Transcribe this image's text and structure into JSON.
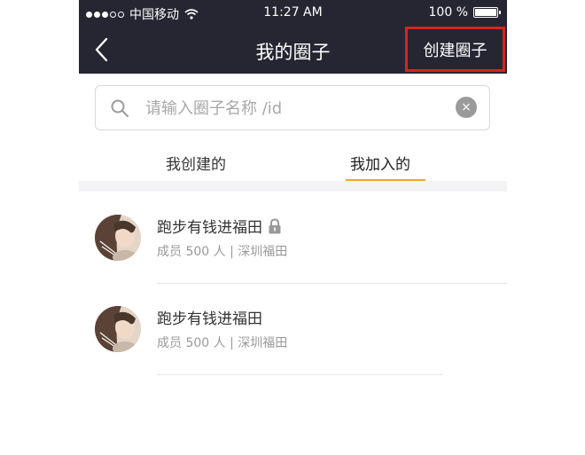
{
  "status_bar": {
    "carrier": "中国移动",
    "time": "11:27 AM",
    "battery": "100 %"
  },
  "navbar": {
    "back_icon": "chevron-left-icon",
    "title": "我的圈子",
    "create_label": "创建圈子"
  },
  "search": {
    "placeholder": "请输入圈子名称 /id",
    "value": "",
    "clear_symbol": "×"
  },
  "tabs": [
    {
      "label": "我创建的",
      "active": false
    },
    {
      "label": "我加入的",
      "active": true
    }
  ],
  "colors": {
    "header_bg": "#262633",
    "accent": "#f5a623",
    "highlight_border": "#d9231d"
  },
  "circles": [
    {
      "name": "跑步有钱进福田",
      "locked": true,
      "meta": "成员 500 人 | 深圳福田"
    },
    {
      "name": "跑步有钱进福田",
      "locked": false,
      "meta": "成员 500 人 | 深圳福田"
    }
  ]
}
